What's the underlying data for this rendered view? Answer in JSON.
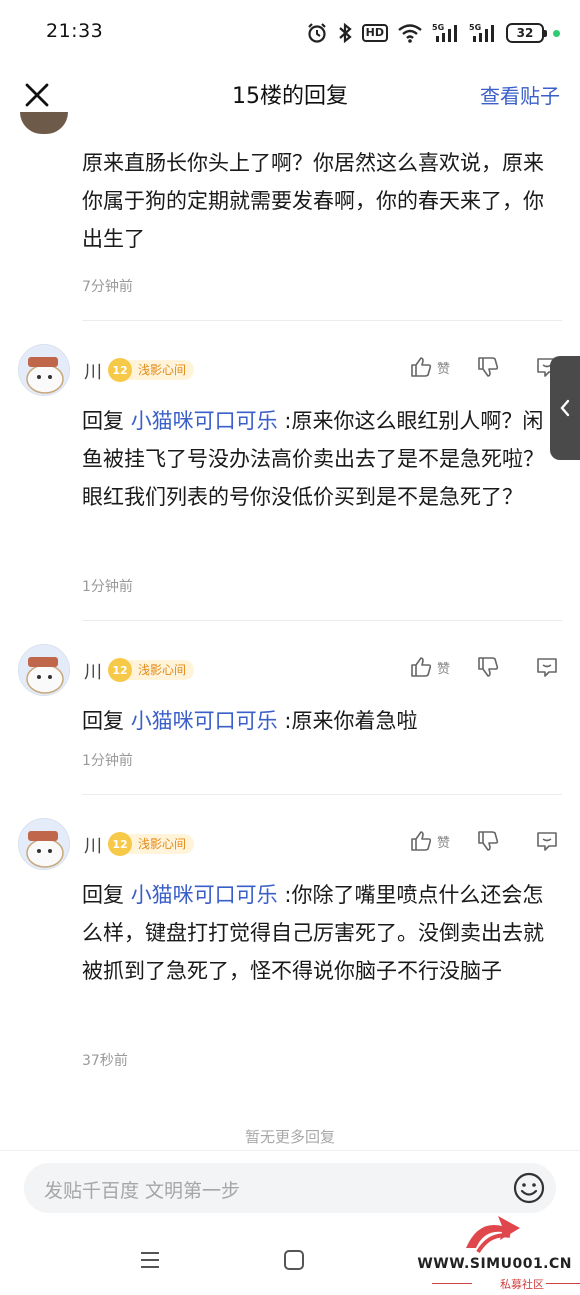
{
  "status_bar": {
    "time": "21:33",
    "battery": "32",
    "icons": [
      "alarm-icon",
      "bluetooth-icon",
      "hd-icon",
      "wifi-icon",
      "signal-5g-icon",
      "signal-5g-icon",
      "battery-icon"
    ]
  },
  "header": {
    "title": "15楼的回复",
    "view_post": "查看贴子"
  },
  "top_comment": {
    "text": "原来直肠长你头上了啊？你居然这么喜欢说，原来你属于狗的定期就需要发春啊，你的春天来了，你出生了",
    "time": "7分钟前"
  },
  "replies": [
    {
      "username": "川",
      "level": "12",
      "level_name": "浅影心间",
      "like_label": "赞",
      "reply_prefix": "回复 ",
      "reply_to": "小猫咪可口可乐",
      "text": " :原来你这么眼红别人啊？闲鱼被挂飞了号没办法高价卖出去了是不是急死啦？眼红我们列表的号你没低价买到是不是急死了？",
      "time": "1分钟前"
    },
    {
      "username": "川",
      "level": "12",
      "level_name": "浅影心间",
      "like_label": "赞",
      "reply_prefix": "回复 ",
      "reply_to": "小猫咪可口可乐",
      "text": " :原来你着急啦",
      "time": "1分钟前"
    },
    {
      "username": "川",
      "level": "12",
      "level_name": "浅影心间",
      "like_label": "赞",
      "reply_prefix": "回复 ",
      "reply_to": "小猫咪可口可乐",
      "text": " :你除了嘴里喷点什么还会怎么样，键盘打打觉得自己厉害死了。没倒卖出去就被抓到了急死了，怪不得说你脑子不行没脑子",
      "time": "37秒前"
    }
  ],
  "no_more": "暂无更多回复",
  "input": {
    "placeholder": "发贴千百度 文明第一步"
  },
  "watermark": {
    "url": "WWW.SIMU001.CN",
    "sub": "私募社区"
  },
  "colors": {
    "accent": "#3a5fc8",
    "level_badge": "#f7c948",
    "level_text": "#e48a1a"
  }
}
